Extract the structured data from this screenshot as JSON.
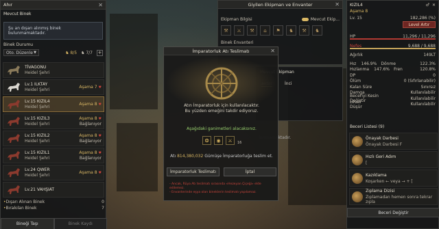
{
  "stable": {
    "title": "Ahır",
    "section_title": "Mevcut Binek",
    "notice": "Şu an dışarı alınmış binek bulunmamaktadır.",
    "status_title": "Binek Durumu",
    "sort_value": "Oto. Düzenle",
    "count_a": "8/5",
    "count_b": "7/7",
    "horses": [
      {
        "name": "TİVAGONU",
        "location": "Heidel Şehri",
        "tier": "",
        "state": ""
      },
      {
        "name": "Lv.1 ILKTAY",
        "location": "Heidel Şehri",
        "tier": "Aşama 7",
        "state": ""
      },
      {
        "name": "Lv.15 KIZIL4",
        "location": "Heidel Şehri",
        "tier": "Aşama 8",
        "state": ""
      },
      {
        "name": "Lv.15 KIZIL3",
        "location": "Heidel Şehri",
        "tier": "Aşama 8",
        "state": "Bağlanıyor"
      },
      {
        "name": "Lv.15 KIZIL2",
        "location": "Heidel Şehri",
        "tier": "Aşama 8",
        "state": "Bağlanıyor"
      },
      {
        "name": "Lv.15 KIZIL1",
        "location": "Heidel Şehri",
        "tier": "Aşama 8",
        "state": "Bağlanıyor"
      },
      {
        "name": "Lv.24 QWER",
        "location": "Heidel Şehri",
        "tier": "Aşama 8",
        "state": ""
      },
      {
        "name": "Lv.21 VAHŞIAT",
        "location": "",
        "tier": "",
        "state": ""
      }
    ],
    "stat1_label": "Dışarı Alınan Binek",
    "stat1_value": "0",
    "stat2_label": "Bırakılan Binek",
    "stat2_value": "7",
    "btn_take": "Bineği Taşı",
    "btn_register": "Binek Kaydı"
  },
  "equip": {
    "title": "Giyilen Ekipman ve Envanter",
    "section1": "Ekipman Bilgisi",
    "toggle_label": "Mevcut Ekip...",
    "section2": "Binek Envanteri",
    "sub_title": "Mevcut Ekipman",
    "sub_tab1": "anter",
    "sub_tab2": "İnci",
    "bg_text": "lunmamaktadır.",
    "slot_icons": [
      "⚒",
      "⚔",
      "⚒",
      "⌂",
      "⚑",
      "♞",
      "⚒",
      "♞"
    ]
  },
  "character": {
    "name": "KIZIL4",
    "tier": "Aşama 8",
    "level": "Lv. 15",
    "exp": "182,286 (%)",
    "lv_button": "Level Artır",
    "hp_label": "HP",
    "hp_value": "11,296 / 11,296",
    "stamina_label": "Nefes",
    "stamina_value": "9,688 / 9,688",
    "weight_label": "Ağırlık",
    "weight_value": "149LT",
    "stats": [
      {
        "l1": "Hız",
        "v1": "146.9%",
        "l2": "Dönme",
        "v2": "122.3%"
      },
      {
        "l1": "Hızlanma",
        "v1": "147.6%",
        "l2": "Fren",
        "v2": "120.8%"
      },
      {
        "l1": "DP",
        "v1": "",
        "l2": "",
        "v2": "0"
      },
      {
        "l1": "Ölüm",
        "v1": "",
        "l2": "",
        "v2": "0 (Sıfırlanabilir)"
      },
      {
        "l1": "Kalan Süre",
        "v1": "",
        "l2": "",
        "v2": "Sınırsız"
      },
      {
        "l1": "Damga",
        "v1": "",
        "l2": "",
        "v2": "Kullanılabilir"
      },
      {
        "l1": "Beceriyi Kesin Değiştir",
        "v1": "",
        "l2": "",
        "v2": "Kullanılabilir"
      },
      {
        "l1": "Level Düşür",
        "v1": "",
        "l2": "",
        "v2": "Kullanılabilir"
      }
    ],
    "skills_title": "Beceri Listesi (9)",
    "skills": [
      {
        "name": "Önayak Darbesi",
        "desc": "Önayak Darbesi F"
      },
      {
        "name": "Hızlı Geri Adım",
        "desc": "[ "
      },
      {
        "name": "Kazıklama",
        "desc": "Koşarken ← veya → + ["
      },
      {
        "name": "Zıplama Dizisi",
        "desc": "Zıplamadan hemen sonra tekrar zıpla"
      }
    ],
    "skill_button": "Beceri Değiştir"
  },
  "modal": {
    "title": "İmparatorluk Atı Teslimatı",
    "text1": "Atın İmparatorluk için kullanılacaktır.",
    "text2": "Bu yüzden emeğini takdir ediyoruz.",
    "rewards_title": "Aşağıdaki ganimetleri alacaksınız.",
    "rewards": [
      "❂",
      "◉",
      "⚔"
    ],
    "reward_count": "16",
    "price_prefix": "Atı",
    "price": "814,380,032",
    "price_suffix": "Gümüşe İmparatorluğa teslim et.",
    "btn_deliver": "İmparatorluk Teslimatı",
    "btn_cancel": "İptal",
    "note1": "- Ancak, Rüya Atı teslimatı sırasında «Hezeyan Çiçeği» elde edilemez.",
    "note2": "- Envanterinde eşya olan bineklerin teslimatı yapılamaz."
  }
}
